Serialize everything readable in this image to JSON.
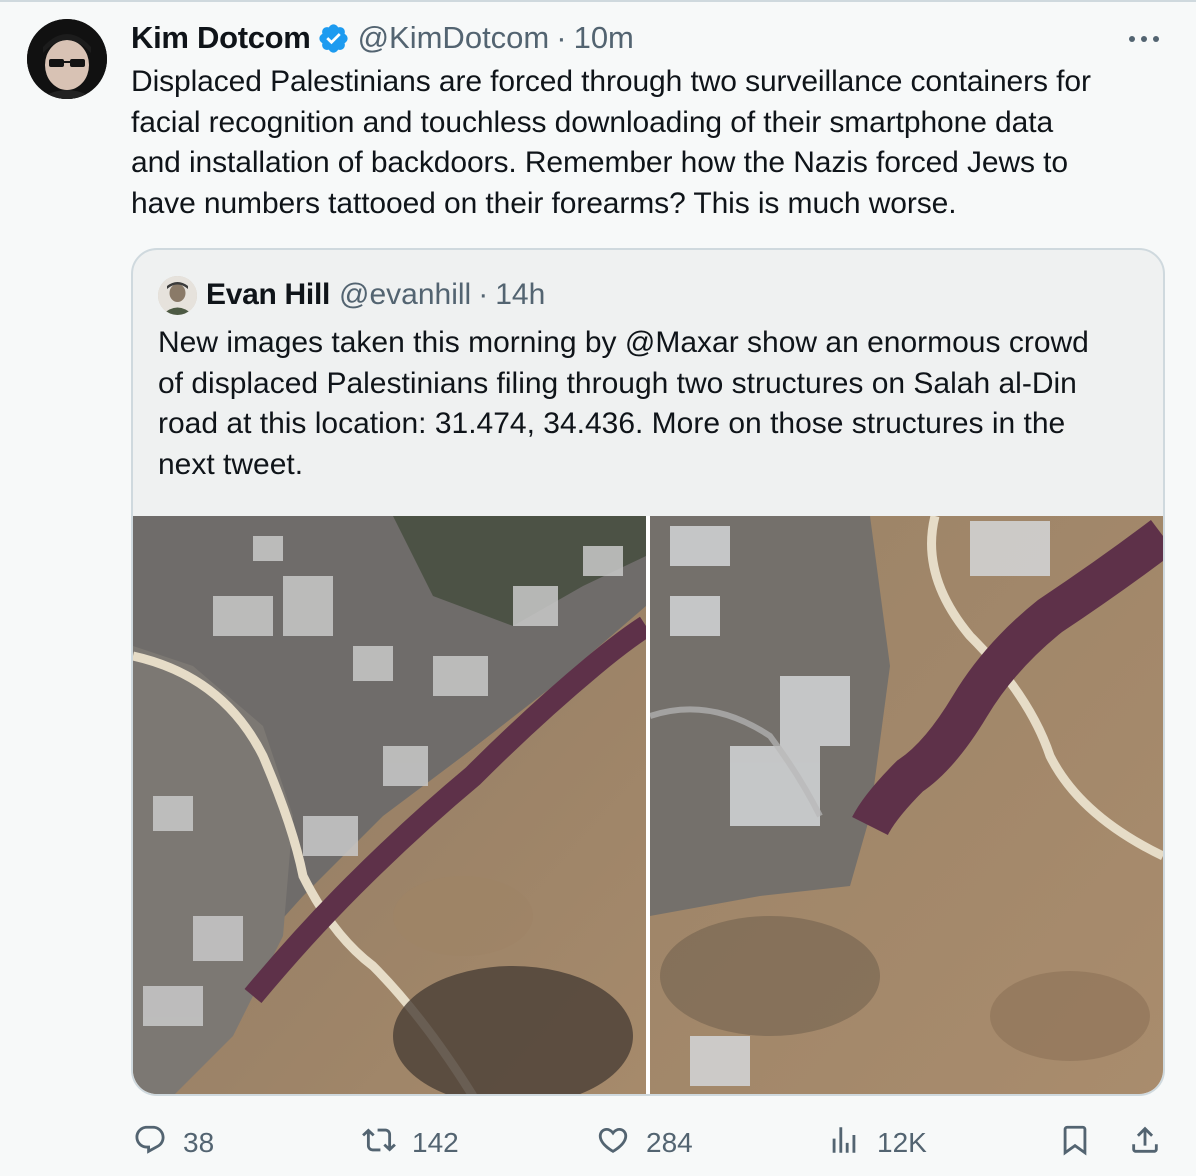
{
  "tweet": {
    "author_name": "Kim Dotcom",
    "handle": "@KimDotcom",
    "separator": "·",
    "time": "10m",
    "text_lines": [
      "Displaced Palestinians are forced through two surveillance containers for",
      "facial recognition and touchless downloading of their smartphone data",
      "and installation of backdoors. Remember how the Nazis forced Jews to",
      "have numbers tattooed on their forearms? This is much worse."
    ],
    "verified": true,
    "accent_color": "#1d9bf0"
  },
  "quoted": {
    "author_name": "Evan Hill",
    "handle": "@evanhill",
    "separator": "·",
    "time": "14h",
    "text_lines": [
      "New images taken this morning by @Maxar show an enormous crowd",
      "of displaced Palestinians filing through two structures on Salah al-Din",
      "road at this location: 31.474, 34.436. More on those structures in the",
      "next tweet."
    ],
    "media": [
      "satellite-image-left",
      "satellite-image-right"
    ]
  },
  "actions": {
    "replies": "38",
    "reposts": "142",
    "likes": "284",
    "views": "12K"
  },
  "icons": [
    "more-icon",
    "reply-icon",
    "repost-icon",
    "like-icon",
    "views-icon",
    "bookmark-icon",
    "share-icon",
    "verified-badge-icon"
  ]
}
